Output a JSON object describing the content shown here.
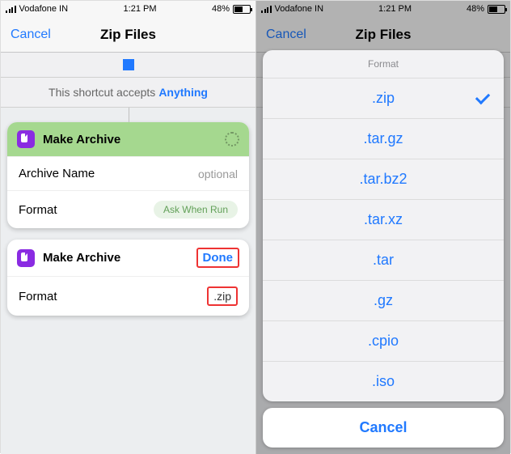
{
  "status": {
    "carrier": "Vodafone IN",
    "time": "1:21 PM",
    "battery_pct": "48%"
  },
  "nav": {
    "cancel": "Cancel",
    "title": "Zip Files"
  },
  "accepts": {
    "prefix": "This shortcut accepts",
    "link": "Anything"
  },
  "card1": {
    "title": "Make Archive",
    "rows": {
      "archive_name": {
        "label": "Archive Name",
        "placeholder": "optional"
      },
      "format": {
        "label": "Format",
        "pill": "Ask When Run"
      }
    }
  },
  "card2": {
    "title": "Make Archive",
    "done": "Done",
    "rows": {
      "format": {
        "label": "Format",
        "value": ".zip"
      }
    }
  },
  "sheet": {
    "title": "Format",
    "options": [
      ".zip",
      ".tar.gz",
      ".tar.bz2",
      ".tar.xz",
      ".tar",
      ".gz",
      ".cpio",
      ".iso"
    ],
    "selected_index": 0,
    "cancel": "Cancel"
  }
}
